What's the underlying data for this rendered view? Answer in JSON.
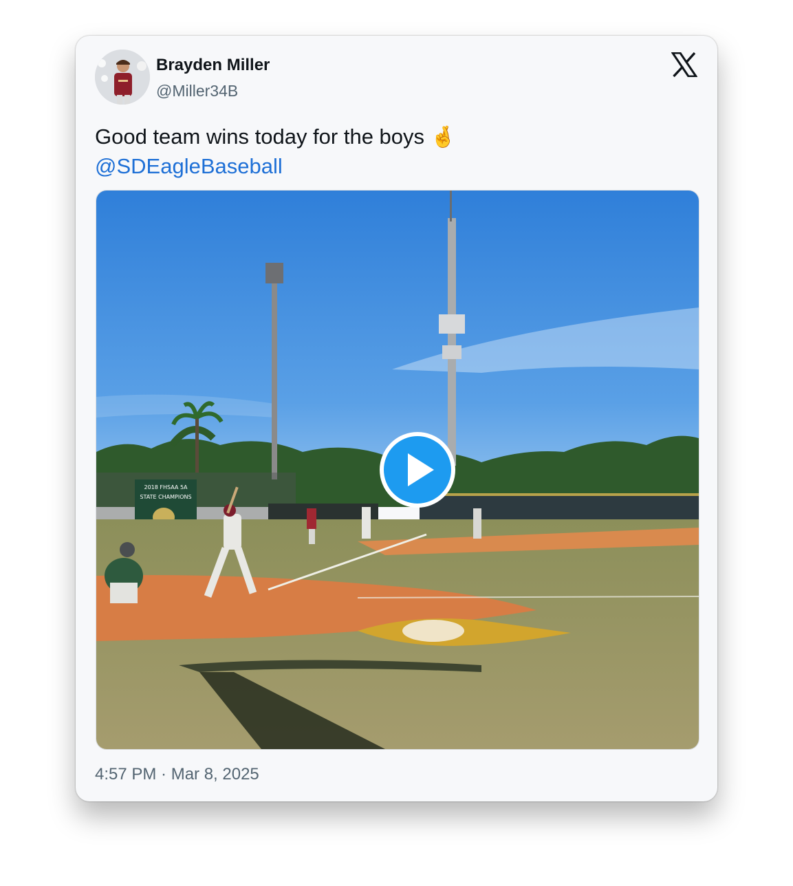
{
  "author": {
    "name": "Brayden Miller",
    "handle": "@Miller34B"
  },
  "tweet": {
    "text": "Good team wins today for the boys",
    "emoji": "🤞",
    "mention": "@SDEagleBaseball"
  },
  "media": {
    "type": "video",
    "banner_line1": "2018 FHSAA 5A",
    "banner_line2": "STATE CHAMPIONS"
  },
  "timestamp": "4:57 PM · Mar 8, 2025",
  "colors": {
    "link": "#1d6fd6",
    "play_button": "#1d9bf0",
    "text": "#0f1419",
    "muted": "#536471"
  },
  "icons": {
    "platform": "x-logo-icon",
    "play": "play-icon"
  }
}
